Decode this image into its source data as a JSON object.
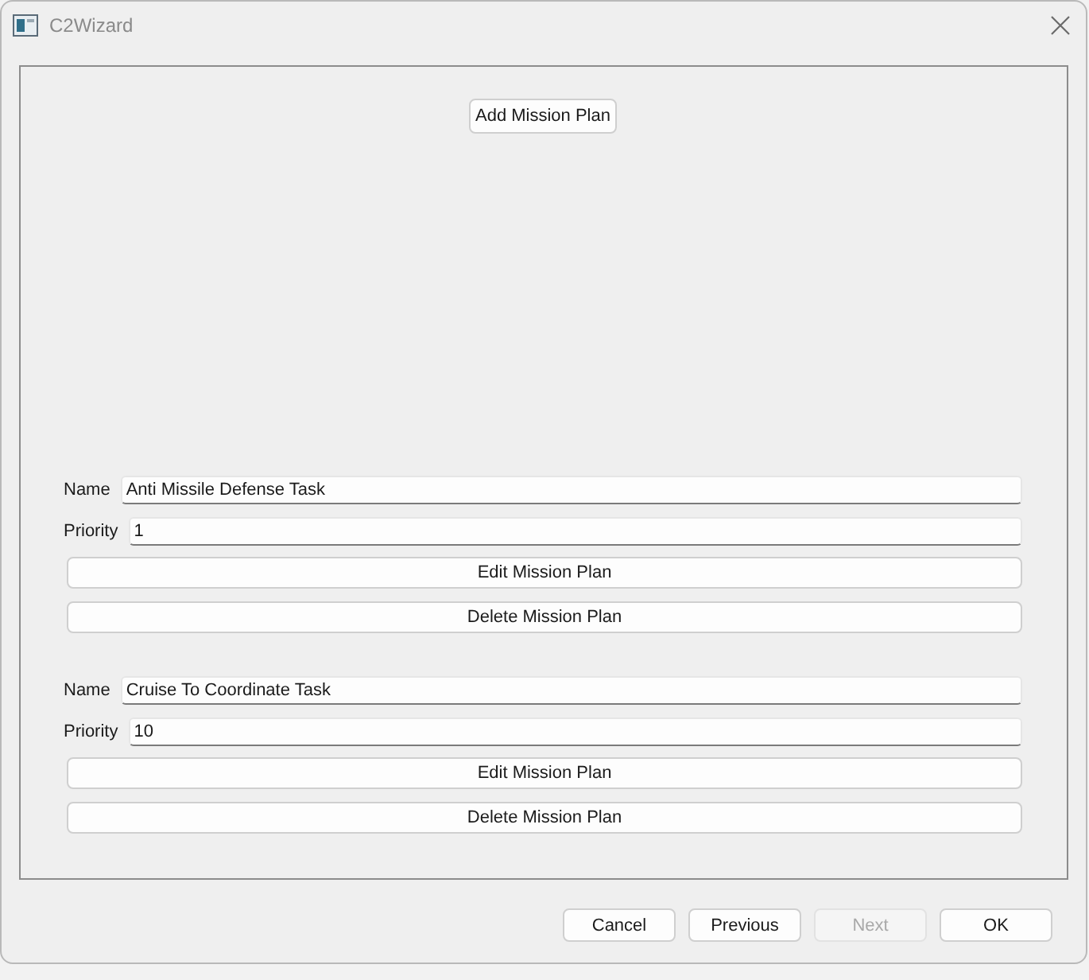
{
  "window": {
    "title": "C2Wizard"
  },
  "add_button": {
    "label": "Add Mission Plan"
  },
  "mission_plans": [
    {
      "name_label": "Name",
      "name": "Anti Missile Defense Task",
      "priority_label": "Priority",
      "priority": "1",
      "edit_button": "Edit Mission Plan",
      "delete_button": "Delete Mission Plan"
    },
    {
      "name_label": "Name",
      "name": "Cruise To Coordinate Task",
      "priority_label": "Priority",
      "priority": "10",
      "edit_button": "Edit Mission Plan",
      "delete_button": "Delete Mission Plan"
    }
  ],
  "buttons": [
    {
      "label": "Cancel",
      "disabled": false
    },
    {
      "label": "Previous",
      "disabled": false
    },
    {
      "label": "Next",
      "disabled": true
    },
    {
      "label": "OK",
      "disabled": false
    }
  ]
}
